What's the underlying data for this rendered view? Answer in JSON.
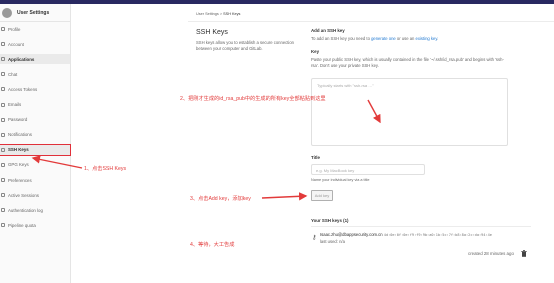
{
  "sidebar": {
    "title": "User Settings",
    "items": [
      {
        "label": "Profile",
        "icon": "profile-icon",
        "state": "normal"
      },
      {
        "label": "Account",
        "icon": "account-icon",
        "state": "normal"
      },
      {
        "label": "Applications",
        "icon": "applications-icon",
        "state": "active"
      },
      {
        "label": "Chat",
        "icon": "chat-icon",
        "state": "normal"
      },
      {
        "label": "Access Tokens",
        "icon": "access-token-icon",
        "state": "normal"
      },
      {
        "label": "Emails",
        "icon": "email-icon",
        "state": "normal"
      },
      {
        "label": "Password",
        "icon": "lock-icon",
        "state": "normal"
      },
      {
        "label": "Notifications",
        "icon": "bell-icon",
        "state": "normal"
      },
      {
        "label": "SSH Keys",
        "icon": "key-icon",
        "state": "boxed"
      },
      {
        "label": "GPG Keys",
        "icon": "key-icon",
        "state": "normal"
      },
      {
        "label": "Preferences",
        "icon": "preferences-icon",
        "state": "normal"
      },
      {
        "label": "Active Sessions",
        "icon": "sessions-icon",
        "state": "normal"
      },
      {
        "label": "Authentication log",
        "icon": "log-icon",
        "state": "normal"
      },
      {
        "label": "Pipeline quota",
        "icon": "pipeline-icon",
        "state": "normal"
      }
    ]
  },
  "breadcrumb": {
    "parent": "User Settings",
    "sep": " > ",
    "current": "SSH Keys"
  },
  "section": {
    "title": "SSH Keys",
    "description": "SSH keys allow you to establish a secure connection between your computer and GitLab."
  },
  "add_key": {
    "heading": "Add an SSH key",
    "intro_prefix": "To add an SSH key you need to ",
    "intro_link1": "generate one",
    "intro_mid": " or use an ",
    "intro_link2": "existing key",
    "intro_suffix": ".",
    "key_label": "Key",
    "key_help": "Paste your public SSH key, which is usually contained in the file '~/.ssh/id_rsa.pub' and begins with 'ssh-rsa'. Don't use your private SSH key.",
    "key_placeholder": "Typically starts with \"ssh-rsa …\"",
    "title_label": "Title",
    "title_placeholder": "e.g. My MacBook key",
    "title_help": "Name your individual key via a title",
    "button": "Add key"
  },
  "your_keys": {
    "heading": "Your SSH keys (1)",
    "owner": "Isaac.zhu@dbappsecurity.com.cn",
    "fingerprint": "4d:0e:0f:0e:f9:f9:9b:a0:1b:5c:7f:b8:8a:2c:da:94:4e",
    "last_used": "last used: n/a",
    "created": "created 28 minutes ago"
  },
  "annotations": {
    "step1": "1、点击SSH Keys",
    "step2": "2、把刚才生成的id_rsa_pub中的生成的所有key全部粘贴到这里",
    "step3": "3、点击Add key，添加key",
    "step4": "4、等待，大工告成"
  },
  "colors": {
    "annotation": "#e23a3a",
    "link": "#1f78d1",
    "topbar": "#292961"
  }
}
